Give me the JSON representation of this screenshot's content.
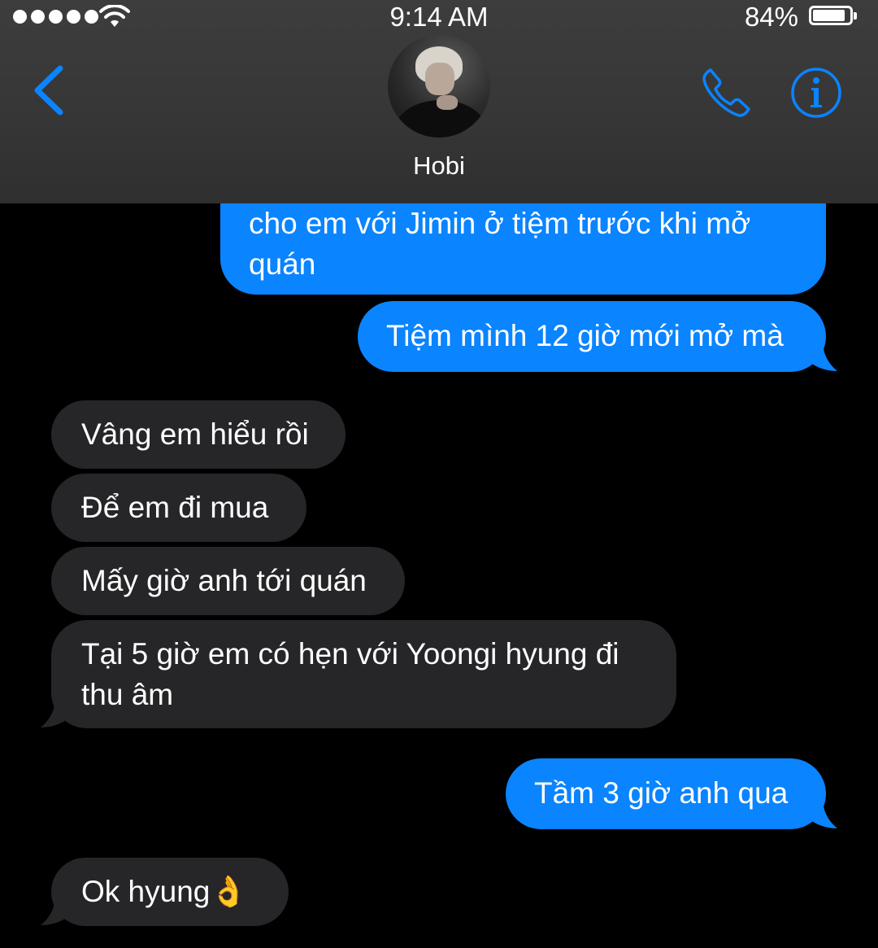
{
  "status_bar": {
    "time": "9:14 AM",
    "battery_percent": "84%",
    "battery_level": 0.84,
    "signal_bars": 5
  },
  "header": {
    "contact_name": "Hobi",
    "back_icon": "chevron-left-icon",
    "call_icon": "phone-icon",
    "info_icon": "info-icon"
  },
  "colors": {
    "accent": "#0a84ff",
    "outgoing_bubble": "#0a84ff",
    "incoming_bubble": "#262628",
    "header_bg": "#363636",
    "background": "#000000"
  },
  "messages": [
    {
      "direction": "outgoing",
      "lines": [
        "cho em với Jimin ở tiệm trước khi mở",
        "quán"
      ]
    },
    {
      "direction": "outgoing",
      "lines": [
        "Tiệm mình 12 giờ mới mở mà"
      ]
    },
    {
      "direction": "incoming",
      "lines": [
        "Vâng em hiểu rồi"
      ]
    },
    {
      "direction": "incoming",
      "lines": [
        "Để em đi mua"
      ]
    },
    {
      "direction": "incoming",
      "lines": [
        "Mấy giờ anh tới quán"
      ]
    },
    {
      "direction": "incoming",
      "lines": [
        "Tại 5 giờ em có hẹn với Yoongi hyung đi",
        "thu âm"
      ]
    },
    {
      "direction": "outgoing",
      "lines": [
        "Tầm 3 giờ anh qua"
      ]
    },
    {
      "direction": "incoming",
      "lines": [
        "Ok hyung👌"
      ]
    }
  ]
}
